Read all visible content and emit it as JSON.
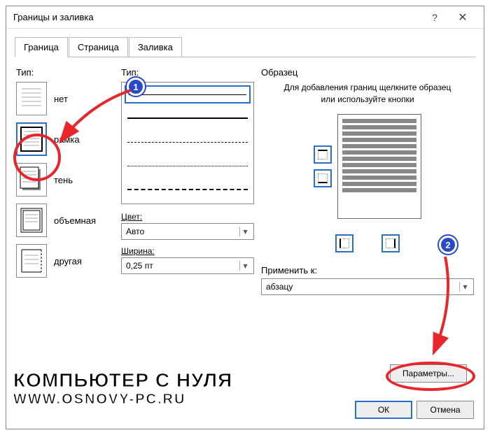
{
  "window": {
    "title": "Границы и заливка"
  },
  "tabs": [
    "Граница",
    "Страница",
    "Заливка"
  ],
  "type": {
    "label": "Тип:",
    "items": [
      {
        "label": "нет"
      },
      {
        "label": "рамка"
      },
      {
        "label": "тень"
      },
      {
        "label": "объемная"
      },
      {
        "label": "другая"
      }
    ]
  },
  "style": {
    "label": "Тип:"
  },
  "color": {
    "label": "Цвет:",
    "value": "Авто"
  },
  "width": {
    "label": "Ширина:",
    "value": "0,25 пт"
  },
  "sample": {
    "label": "Образец",
    "hint": "Для добавления границ щелкните образец или используйте кнопки"
  },
  "apply": {
    "label": "Применить к:",
    "value": "абзацу"
  },
  "buttons": {
    "params": "Параметры...",
    "ok": "ОК",
    "cancel": "Отмена"
  },
  "annotation": {
    "b1": "1",
    "b2": "2"
  },
  "watermark": {
    "line1": "КОМПЬЮТЕР С НУЛЯ",
    "line2": "WWW.OSNOVY-PC.RU"
  }
}
